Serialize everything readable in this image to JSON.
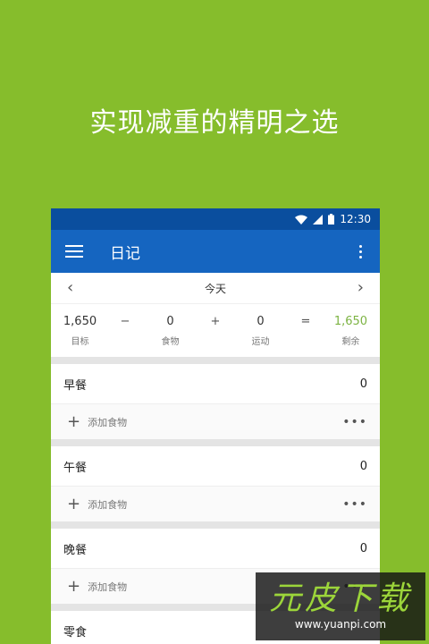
{
  "tagline": "实现减重的精明之选",
  "statusbar": {
    "time": "12:30",
    "icons": [
      "wifi-icon",
      "signal-icon",
      "battery-icon"
    ]
  },
  "appbar": {
    "title": "日记",
    "menu_icon": "hamburger-icon",
    "more_icon": "overflow-icon"
  },
  "date": {
    "label": "今天",
    "prev": "‹",
    "next": "›"
  },
  "summary": {
    "goal": {
      "value": "1,650",
      "label": "目标"
    },
    "minus": "−",
    "food": {
      "value": "0",
      "label": "食物"
    },
    "plus": "+",
    "exercise": {
      "value": "0",
      "label": "运动"
    },
    "equals": "=",
    "remaining": {
      "value": "1,650",
      "label": "剩余"
    }
  },
  "meals": [
    {
      "name": "早餐",
      "calories": "0",
      "add_label": "添加食物"
    },
    {
      "name": "午餐",
      "calories": "0",
      "add_label": "添加食物"
    },
    {
      "name": "晚餐",
      "calories": "0",
      "add_label": "添加食物"
    },
    {
      "name": "零食",
      "calories": "",
      "add_label": ""
    }
  ],
  "watermark": {
    "title": "元皮下载",
    "url": "www.yuanpi.com"
  },
  "colors": {
    "background": "#86bd2c",
    "appbar": "#1565c0",
    "statusbar": "#0a4e9e",
    "accent_green": "#7cb342"
  }
}
